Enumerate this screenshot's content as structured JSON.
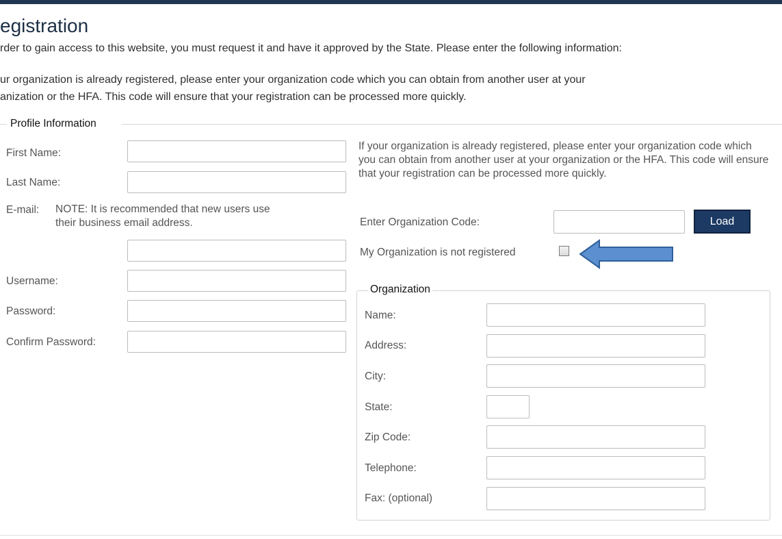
{
  "header": {
    "title": "egistration",
    "intro_line1": "rder to gain access to this website, you must request it and have it approved by the State.  Please enter the following information:",
    "intro_line2": "ur organization is already registered, please enter your organization code which you can obtain from another user at your",
    "intro_line3": "anization or the HFA. This code will ensure that your registration can be processed more quickly."
  },
  "profile": {
    "legend": "Profile Information",
    "first_name_label": "First Name:",
    "last_name_label": "Last Name:",
    "email_label": "E-mail:",
    "email_note_line1": "NOTE: It is recommended that new users use",
    "email_note_line2": "their business email address.",
    "username_label": "Username:",
    "password_label": "Password:",
    "confirm_password_label": "Confirm Password:"
  },
  "org_code": {
    "info_text": "If your organization is already registered, please enter your organization code which you can obtain from another user at your organization or the HFA. This code will ensure that your registration can be processed more quickly.",
    "code_label": "Enter Organization Code:",
    "load_button": "Load",
    "not_registered_label": "My Organization is not registered",
    "not_registered_checked": false
  },
  "organization": {
    "legend": "Organization",
    "name_label": "Name:",
    "address_label": "Address:",
    "city_label": "City:",
    "state_label": "State:",
    "zip_label": "Zip Code:",
    "telephone_label": "Telephone:",
    "fax_label": "Fax: (optional)"
  },
  "annotation": {
    "arrow_color": "#5b8fd0",
    "arrow_outline": "#2f5f9a",
    "arrow_icon": "left-arrow-icon"
  }
}
